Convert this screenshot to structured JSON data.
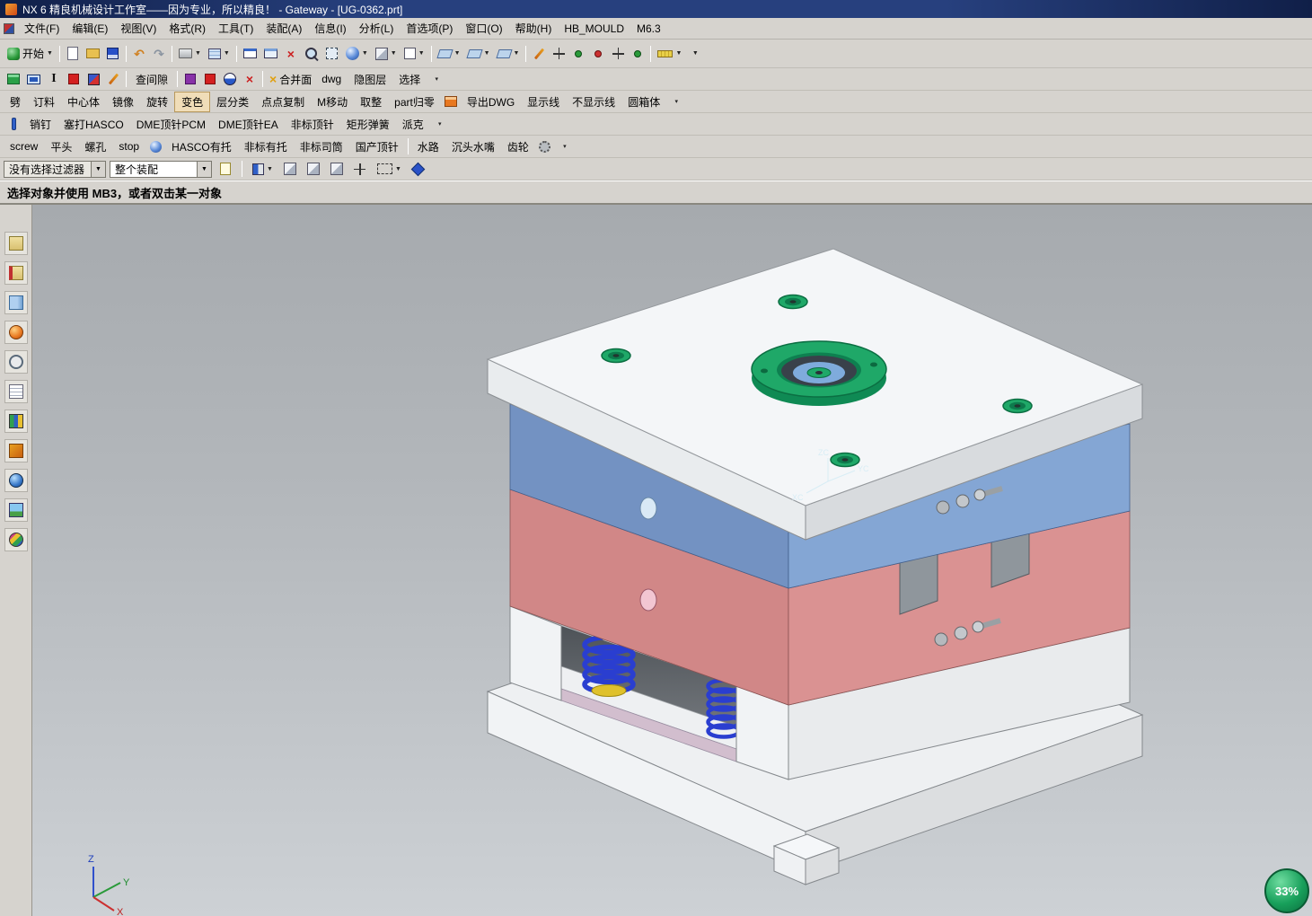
{
  "titlebar": {
    "title": "NX 6 精良机械设计工作室——因为专业，所以精良！ - Gateway - [UG-0362.prt]"
  },
  "menubar": {
    "items": [
      "文件(F)",
      "编辑(E)",
      "视图(V)",
      "格式(R)",
      "工具(T)",
      "装配(A)",
      "信息(I)",
      "分析(L)",
      "首选项(P)",
      "窗口(O)",
      "帮助(H)",
      "HB_MOULD",
      "M6.3"
    ]
  },
  "icons": {
    "caret": "▼",
    "caret_small": "▾",
    "x_mark": "×",
    "undo": "↶",
    "redo": "↷",
    "bold_i": "I"
  },
  "toolbar_main": {
    "start": "开始"
  },
  "toolbar_custom1": {
    "check_gap": "查间隙",
    "merge_face": "合并面",
    "dwg": "dwg",
    "hide_layer": "隐图层",
    "select": "选择"
  },
  "toolbar_custom2": {
    "items": [
      "劈",
      "订料",
      "中心体",
      "镜像",
      "旋转",
      "变色",
      "层分类",
      "点点复制",
      "M移动",
      "取整",
      "part归零",
      "导出DWG",
      "显示线",
      "不显示线",
      "圆箱体"
    ]
  },
  "toolbar_custom3": {
    "items": [
      "销钉",
      "塞打HASCO",
      "DME顶针PCM",
      "DME顶针EA",
      "非标顶针",
      "矩形弹簧",
      "派克"
    ]
  },
  "toolbar_custom4": {
    "items": [
      "screw",
      "平头",
      "螺孔",
      "stop",
      "HASCO有托",
      "非标有托",
      "非标司筒",
      "国产顶针",
      "水路",
      "沉头水嘴",
      "齿轮"
    ]
  },
  "selection_bar": {
    "filter_value": "没有选择过滤器",
    "scope_value": "整个装配"
  },
  "prompt_bar": {
    "message": "选择对象并使用 MB3，或者双击某一对象"
  },
  "viewport": {
    "progress_label": "33%",
    "triad": {
      "x": "X",
      "y": "Y",
      "z": "Z"
    },
    "wcs": {
      "xc": "XC",
      "yc": "YC",
      "zc": "ZC"
    }
  },
  "colors": {
    "top_plate": "#f4f6f8",
    "top_plate_left": "#e9ecee",
    "top_plate_right": "#d8dbde",
    "a_plate_left": "#7392c2",
    "a_plate_right": "#84a6d4",
    "b_plate_left": "#d18787",
    "b_plate_right": "#da9292",
    "base_plate": "#eef0f2",
    "ring_green": "#1fa868",
    "spring_blue": "#2a3ed0",
    "progress_green": "#18a05b"
  }
}
